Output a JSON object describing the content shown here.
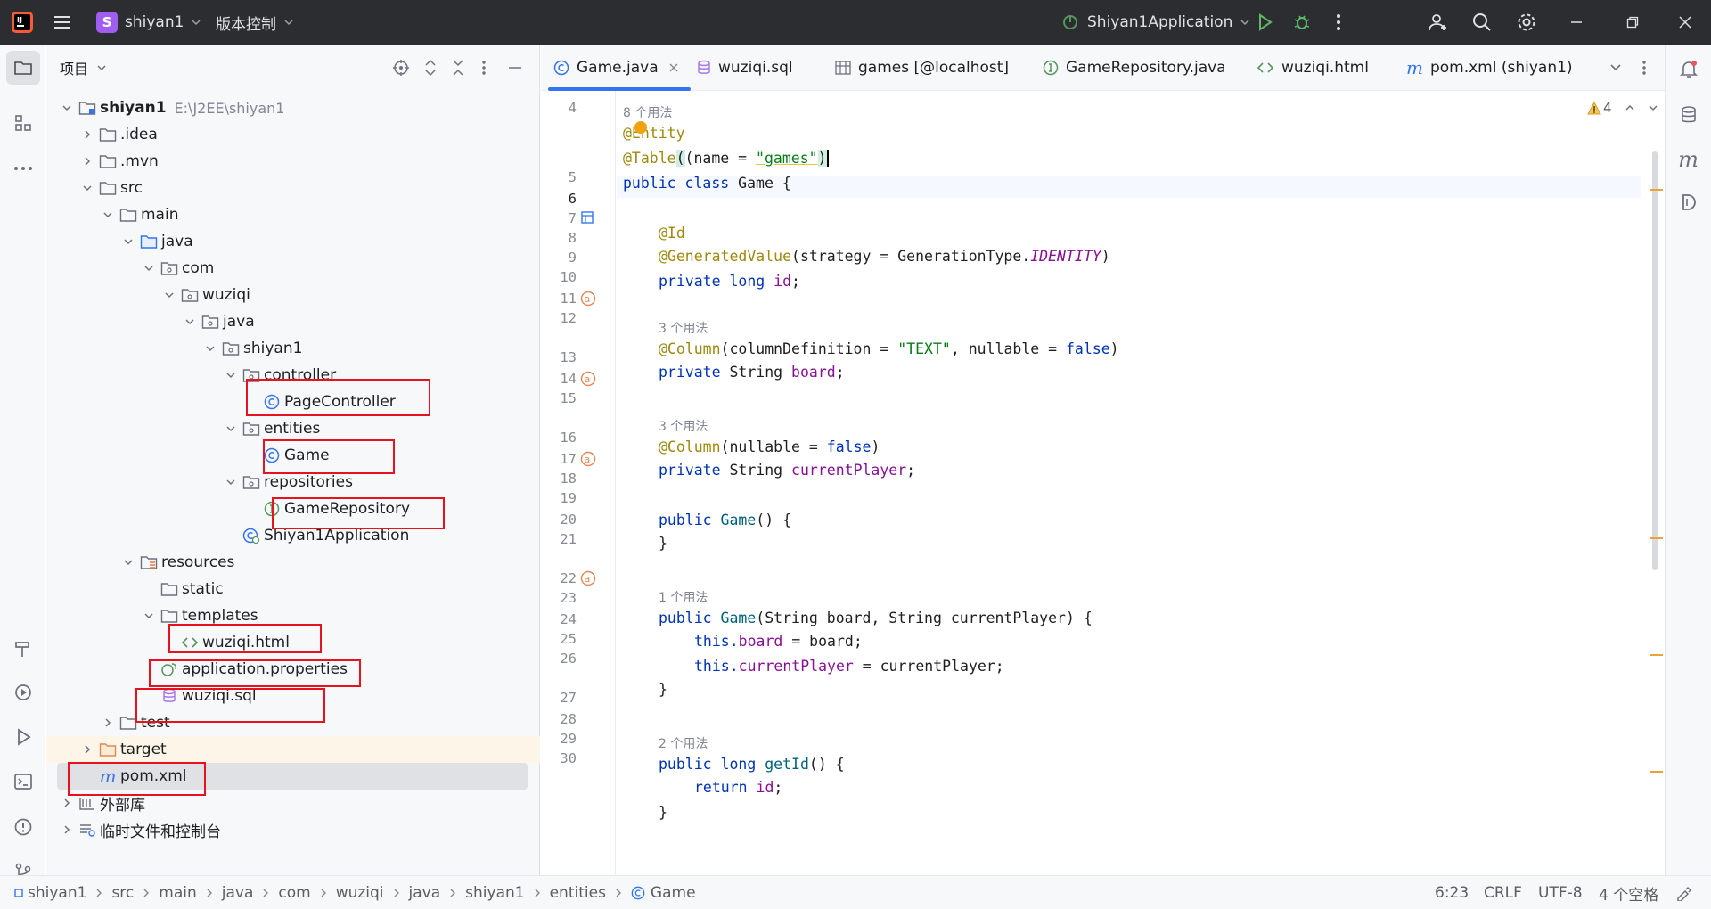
{
  "titlebar": {
    "project_initial": "S",
    "project_name": "shiyan1",
    "vcs": "版本控制",
    "run_config": "Shiyan1Application"
  },
  "project_panel": {
    "title": "项目",
    "tree": [
      {
        "label": "shiyan1",
        "hint": "E:\\J2EE\\shiyan1"
      },
      {
        "label": ".idea"
      },
      {
        "label": ".mvn"
      },
      {
        "label": "src"
      },
      {
        "label": "main"
      },
      {
        "label": "java"
      },
      {
        "label": "com"
      },
      {
        "label": "wuziqi"
      },
      {
        "label": "java"
      },
      {
        "label": "shiyan1"
      },
      {
        "label": "controller"
      },
      {
        "label": "PageController"
      },
      {
        "label": "entities"
      },
      {
        "label": "Game"
      },
      {
        "label": "repositories"
      },
      {
        "label": "GameRepository"
      },
      {
        "label": "Shiyan1Application"
      },
      {
        "label": "resources"
      },
      {
        "label": "static"
      },
      {
        "label": "templates"
      },
      {
        "label": "wuziqi.html"
      },
      {
        "label": "application.properties"
      },
      {
        "label": "wuziqi.sql"
      },
      {
        "label": "test"
      },
      {
        "label": "target"
      },
      {
        "label": "pom.xml"
      },
      {
        "label": "外部库"
      },
      {
        "label": "临时文件和控制台"
      }
    ]
  },
  "tabs": [
    {
      "label": "Game.java",
      "active": true
    },
    {
      "label": "wuziqi.sql"
    },
    {
      "label": "games [@localhost]"
    },
    {
      "label": "GameRepository.java"
    },
    {
      "label": "wuziqi.html"
    },
    {
      "label": "pom.xml (shiyan1)"
    }
  ],
  "inspections": {
    "warning_count": "4"
  },
  "editor": {
    "line_numbers": [
      "4",
      "5",
      "6",
      "7",
      "8",
      "9",
      "10",
      "11",
      "12",
      "13",
      "14",
      "15",
      "16",
      "17",
      "18",
      "19",
      "20",
      "21",
      "22",
      "23",
      "24",
      "25",
      "26",
      "27",
      "28",
      "29",
      "30"
    ],
    "usage_hints": [
      "8 个用法",
      "3 个用法",
      "3 个用法",
      "1 个用法",
      "2 个用法"
    ],
    "code": {
      "l5": "@Entity",
      "l6a": "@Table",
      "l6b": "(name = ",
      "l6c": "\"games\"",
      "l6d": ")",
      "l7a": "public class ",
      "l7b": "Game {",
      "l9": "@Id",
      "l10a": "@GeneratedValue",
      "l10b": "(strategy = GenerationType.",
      "l10c": "IDENTITY",
      "l10d": ")",
      "l11a": "private long ",
      "l11b": "id",
      "l11c": ";",
      "l13a": "@Column",
      "l13b": "(columnDefinition = ",
      "l13c": "\"TEXT\"",
      "l13d": ", nullable = ",
      "l13e": "false",
      "l13f": ")",
      "l14a": "private ",
      "l14b": "String ",
      "l14c": "board",
      "l14d": ";",
      "l16a": "@Column",
      "l16b": "(nullable = ",
      "l16c": "false",
      "l16d": ")",
      "l17a": "private ",
      "l17b": "String ",
      "l17c": "currentPlayer",
      "l17d": ";",
      "l19a": "public ",
      "l19b": "Game",
      "l19c": "() {",
      "l20": "}",
      "l22a": "public ",
      "l22b": "Game",
      "l22c": "(String board, String currentPlayer) {",
      "l23a": "this.",
      "l23b": "board",
      "l23c": " = board;",
      "l24a": "this.",
      "l24b": "currentPlayer",
      "l24c": " = currentPlayer;",
      "l25": "}",
      "l27a": "public long ",
      "l27b": "getId",
      "l27c": "() {",
      "l28a": "return ",
      "l28b": "id",
      "l28c": ";",
      "l29": "}"
    }
  },
  "statusbar": {
    "breadcrumbs": [
      "shiyan1",
      "src",
      "main",
      "java",
      "com",
      "wuziqi",
      "java",
      "shiyan1",
      "entities",
      "Game"
    ],
    "position": "6:23",
    "line_sep": "CRLF",
    "encoding": "UTF-8",
    "indent": "4 个空格"
  },
  "colors": {
    "titlebar_bg": "#2b2d30",
    "accent": "#3574f0",
    "highlight_box": "#e8121e",
    "keyword": "#0033b3",
    "annotation": "#9e880d",
    "string": "#067d17",
    "field": "#871094"
  }
}
